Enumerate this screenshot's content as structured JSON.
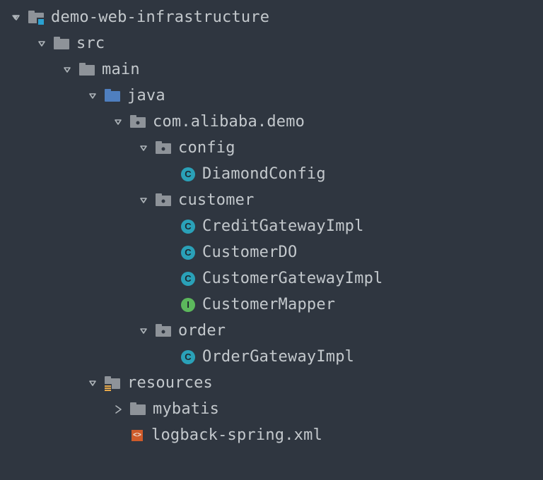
{
  "tree": {
    "root": {
      "label": "demo-web-infrastructure",
      "expanded": true,
      "icon": "module-folder",
      "children": {
        "src": {
          "label": "src",
          "expanded": true,
          "icon": "folder",
          "children": {
            "main": {
              "label": "main",
              "expanded": true,
              "icon": "folder",
              "children": {
                "java": {
                  "label": "java",
                  "expanded": true,
                  "icon": "source-folder",
                  "children": {
                    "pkg": {
                      "label": "com.alibaba.demo",
                      "expanded": true,
                      "icon": "package",
                      "children": {
                        "config": {
                          "label": "config",
                          "expanded": true,
                          "icon": "package",
                          "children": {
                            "DiamondConfig": {
                              "label": "DiamondConfig",
                              "icon": "class"
                            }
                          }
                        },
                        "customer": {
                          "label": "customer",
                          "expanded": true,
                          "icon": "package",
                          "children": {
                            "CreditGatewayImpl": {
                              "label": "CreditGatewayImpl",
                              "icon": "class"
                            },
                            "CustomerDO": {
                              "label": "CustomerDO",
                              "icon": "class"
                            },
                            "CustomerGatewayImpl": {
                              "label": "CustomerGatewayImpl",
                              "icon": "class"
                            },
                            "CustomerMapper": {
                              "label": "CustomerMapper",
                              "icon": "interface"
                            }
                          }
                        },
                        "order": {
                          "label": "order",
                          "expanded": true,
                          "icon": "package",
                          "children": {
                            "OrderGatewayImpl": {
                              "label": "OrderGatewayImpl",
                              "icon": "class"
                            }
                          }
                        }
                      }
                    }
                  }
                },
                "resources": {
                  "label": "resources",
                  "expanded": true,
                  "icon": "resources-folder",
                  "children": {
                    "mybatis": {
                      "label": "mybatis",
                      "expanded": false,
                      "icon": "folder"
                    },
                    "logback": {
                      "label": "logback-spring.xml",
                      "icon": "xml-file"
                    }
                  }
                }
              }
            }
          }
        }
      }
    }
  },
  "glyph": {
    "class": "C",
    "interface": "I",
    "xml": "<>"
  }
}
